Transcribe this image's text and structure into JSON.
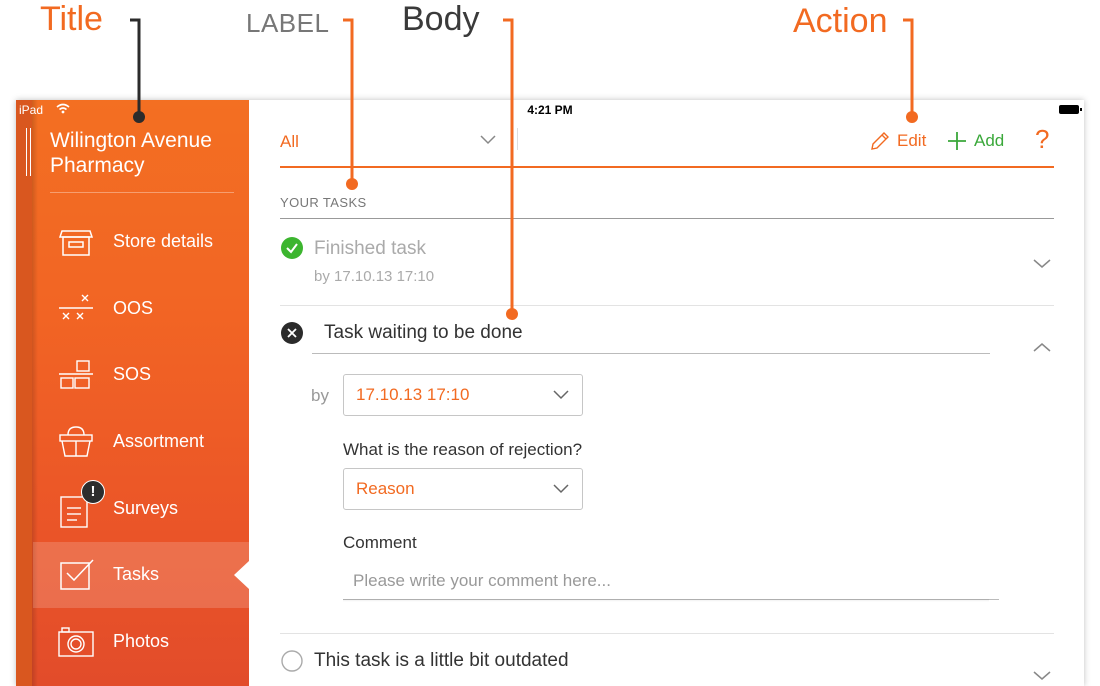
{
  "annotations": {
    "title": "Title",
    "label": "LABEL",
    "body": "Body",
    "action": "Action"
  },
  "status_bar": {
    "device": "iPad",
    "time": "4:21 PM"
  },
  "sidebar": {
    "store_name": "Wilington  Avenue Pharmacy",
    "items": [
      {
        "label": "Store details",
        "icon": "store-icon"
      },
      {
        "label": "OOS",
        "icon": "oos-icon"
      },
      {
        "label": "SOS",
        "icon": "sos-icon"
      },
      {
        "label": "Assortment",
        "icon": "basket-icon"
      },
      {
        "label": "Surveys",
        "icon": "clipboard-icon",
        "badge": "!"
      },
      {
        "label": "Tasks",
        "icon": "checkbox-icon",
        "active": true
      },
      {
        "label": "Photos",
        "icon": "camera-icon"
      }
    ]
  },
  "toolbar": {
    "filter": "All",
    "edit_label": "Edit",
    "add_label": "Add",
    "help_label": "?"
  },
  "tasks_section": {
    "label": "YOUR TASKS",
    "tasks": [
      {
        "title": "Finished task",
        "due": "by 17.10.13 17:10",
        "state": "done"
      },
      {
        "title": "Task waiting to be done",
        "state": "rejected",
        "expanded": true,
        "by_label": "by",
        "due": "17.10.13 17:10",
        "reason_question": "What is the reason of rejection?",
        "reason_value": "Reason",
        "comment_label": "Comment",
        "comment_placeholder": "Please write your comment here..."
      },
      {
        "title": "This task is a little bit outdated",
        "state": "open"
      }
    ]
  },
  "colors": {
    "accent": "#f26a21",
    "success": "#3cb52f",
    "add_green": "#3aa83a"
  }
}
